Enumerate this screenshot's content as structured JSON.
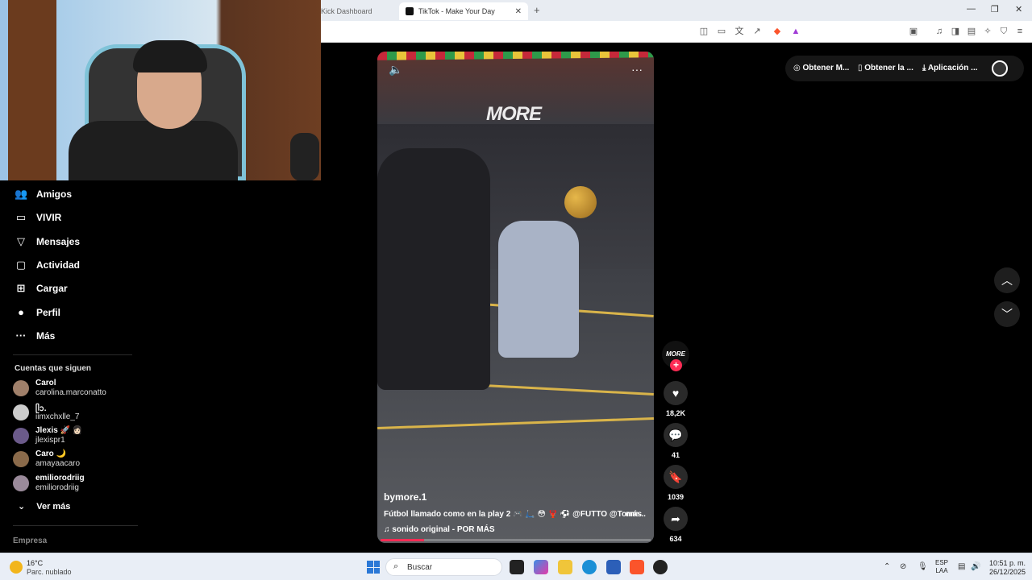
{
  "browser": {
    "tabs": [
      {
        "label": "Kick Dashboard",
        "active": false
      },
      {
        "label": "TikTok - Make Your Day",
        "active": true
      }
    ],
    "new_tab": "+",
    "window_controls": {
      "minimize": "—",
      "restore": "❐",
      "close": "✕"
    }
  },
  "sidebar": {
    "nav": [
      {
        "label": "Amigos",
        "icon": "friends-icon",
        "glyph": "👥"
      },
      {
        "label": "VIVIR",
        "icon": "live-icon",
        "glyph": "▭"
      },
      {
        "label": "Mensajes",
        "icon": "messages-icon",
        "glyph": "▽"
      },
      {
        "label": "Actividad",
        "icon": "activity-icon",
        "glyph": "▢"
      },
      {
        "label": "Cargar",
        "icon": "upload-icon",
        "glyph": "⊞"
      },
      {
        "label": "Perfil",
        "icon": "profile-icon",
        "glyph": "●"
      },
      {
        "label": "Más",
        "icon": "more-icon",
        "glyph": "···"
      }
    ],
    "following_title": "Cuentas que siguen",
    "accounts": [
      {
        "name": "Carol",
        "username": "carolina.marconatto",
        "color": "#a0806a"
      },
      {
        "name": "ᥫᩣ.",
        "username": "iimxchxlle_7",
        "color": "#cccccc"
      },
      {
        "name": "Jlexis 🚀 👩🏻",
        "username": "jlexispr1",
        "color": "#6b5a8a"
      },
      {
        "name": "Caro 🌙",
        "username": "amayaacaro",
        "color": "#8a6a4a"
      },
      {
        "name": "emiliorodriig",
        "username": "emiliorodriig",
        "color": "#9a8a9a"
      }
    ],
    "see_more": "Ver más",
    "footer": "Empresa"
  },
  "video": {
    "logo_text": "MORE",
    "author": "bymore.1",
    "caption": "Fútbol llamado como en la play 2 🎮 🛴 😳 🦞 ⚽ @FUTTO @Torne...",
    "caption_more": "más",
    "sound": "sonido original - POR MÁS",
    "progress": 0.16
  },
  "actions": {
    "author_badge": "MORE",
    "likes": "18,2K",
    "comments": "41",
    "saves": "1039",
    "shares": "634"
  },
  "topbar": {
    "link1": "Obtener M...",
    "link2": "Obtener la ...",
    "link3": "Aplicación ..."
  },
  "taskbar": {
    "temperature": "16°C",
    "condition": "Parc. nublado",
    "search_placeholder": "Buscar",
    "lang_line1": "ESP",
    "lang_line2": "LAA",
    "time": "10:51 p. m.",
    "date": "26/12/2025"
  }
}
